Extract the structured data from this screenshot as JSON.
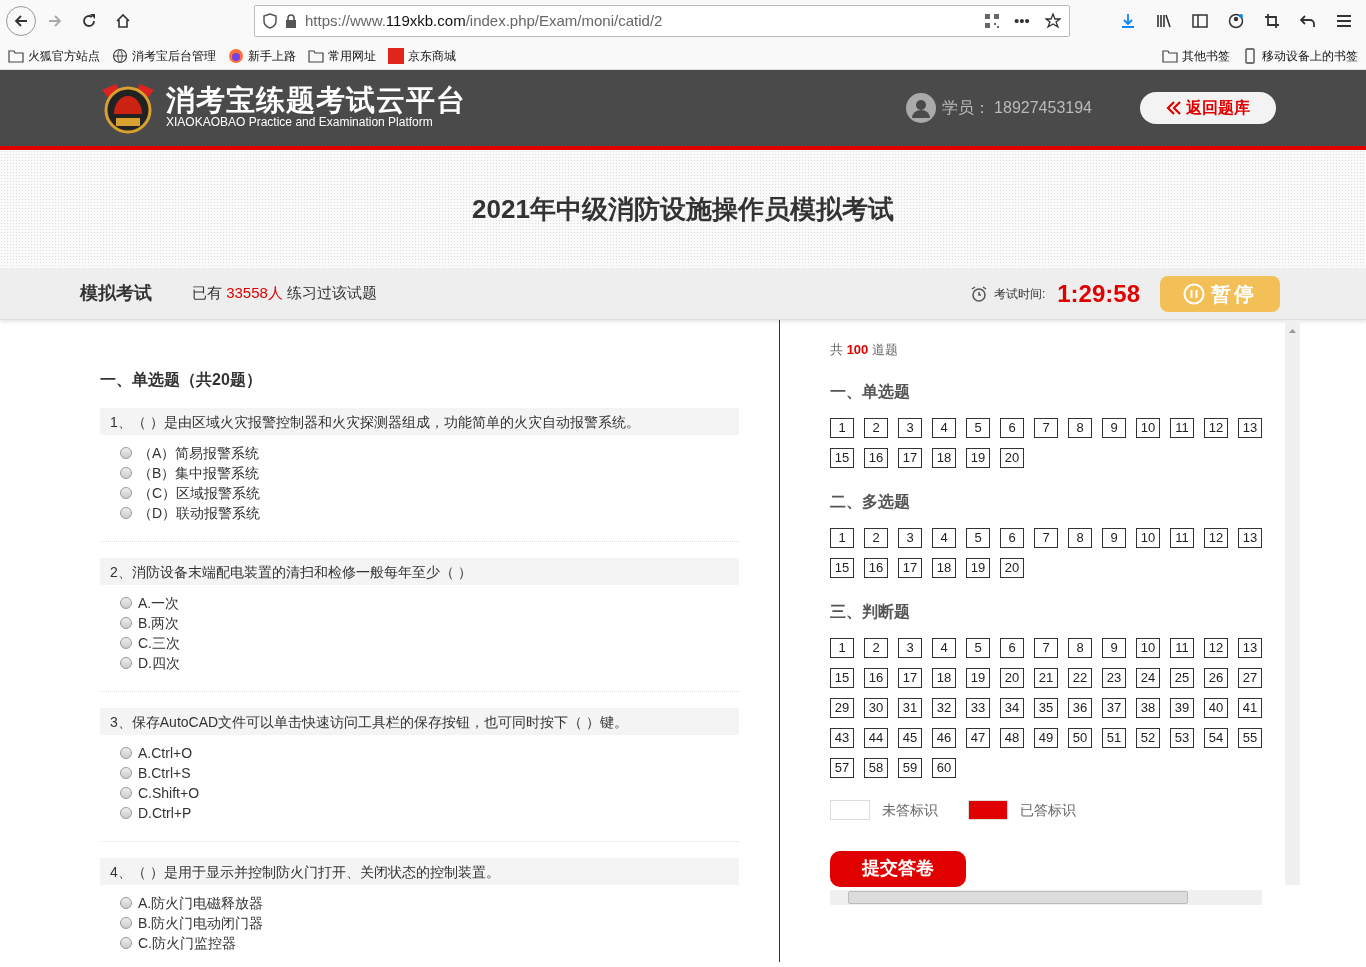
{
  "browser": {
    "url_prefix": "https://www.",
    "url_domain": "119xkb.com",
    "url_path": "/index.php/Exam/moni/catid/2",
    "menu_glyph": "•••",
    "bookmarks": [
      {
        "label": "火狐官方站点",
        "kind": "folder"
      },
      {
        "label": "消考宝后台管理",
        "kind": "globe"
      },
      {
        "label": "新手上路",
        "kind": "firefox"
      },
      {
        "label": "常用网址",
        "kind": "folder"
      },
      {
        "label": "京东商城",
        "kind": "jd"
      }
    ],
    "bookmarks_right": [
      {
        "label": "其他书签",
        "kind": "folder"
      },
      {
        "label": "移动设备上的书签",
        "kind": "mobile"
      }
    ]
  },
  "header": {
    "logo_title": "消考宝练题考试云平台",
    "logo_subtitle": "XIAOKAOBAO Practice and Examination Platform",
    "user_label": "学员：",
    "user_id": "18927453194",
    "back_button": "返回题库"
  },
  "exam_title": "2021年中级消防设施操作员模拟考试",
  "exam_bar": {
    "mode": "模拟考试",
    "count_prefix": "已有",
    "count": "33558人",
    "count_suffix": "练习过该试题",
    "timer_label": "考试时间:",
    "timer": "1:29:58",
    "pause_button": "暂停"
  },
  "section_title": "一、单选题（共20题）",
  "questions": [
    {
      "text": "1、（ ）是由区域火灾报警控制器和火灾探测器组成，功能简单的火灾自动报警系统。",
      "options": [
        {
          "label": "（A）简易报警系统",
          "selected": false
        },
        {
          "label": "（B）集中报警系统",
          "selected": false
        },
        {
          "label": "（C）区域报警系统",
          "selected": false
        },
        {
          "label": "（D）联动报警系统",
          "selected": false
        }
      ]
    },
    {
      "text": "2、消防设备末端配电装置的清扫和检修一般每年至少（ ）",
      "options": [
        {
          "label": "A.一次",
          "selected": false
        },
        {
          "label": "B.两次",
          "selected": false
        },
        {
          "label": "C.三次",
          "selected": false
        },
        {
          "label": "D.四次",
          "selected": false
        }
      ]
    },
    {
      "text": "3、保存AutoCAD文件可以单击快速访问工具栏的保存按钮，也可同时按下（ ）键。",
      "options": [
        {
          "label": "A.Ctrl+O",
          "selected": false
        },
        {
          "label": "B.Ctrl+S",
          "selected": false
        },
        {
          "label": "C.Shift+O",
          "selected": false
        },
        {
          "label": "D.Ctrl+P",
          "selected": false
        }
      ]
    },
    {
      "text": "4、（ ）是用于显示并控制防火门打开、关闭状态的控制装置。",
      "options": [
        {
          "label": "A.防火门电磁释放器",
          "selected": false
        },
        {
          "label": "B.防火门电动闭门器",
          "selected": false
        },
        {
          "label": "C.防火门监控器",
          "selected": false
        }
      ]
    }
  ],
  "navigator": {
    "total_prefix": "共",
    "total": "100",
    "total_suffix": "道题",
    "sections": [
      {
        "title": "一、单选题",
        "numbers": [
          "1",
          "2",
          "3",
          "4",
          "5",
          "6",
          "7",
          "8",
          "9",
          "10",
          "11",
          "12",
          "13",
          "15",
          "16",
          "17",
          "18",
          "19",
          "20"
        ]
      },
      {
        "title": "二、多选题",
        "numbers": [
          "1",
          "2",
          "3",
          "4",
          "5",
          "6",
          "7",
          "8",
          "9",
          "10",
          "11",
          "12",
          "13",
          "15",
          "16",
          "17",
          "18",
          "19",
          "20"
        ]
      },
      {
        "title": "三、判断题",
        "numbers": [
          "1",
          "2",
          "3",
          "4",
          "5",
          "6",
          "7",
          "8",
          "9",
          "10",
          "11",
          "12",
          "13",
          "15",
          "16",
          "17",
          "18",
          "19",
          "20",
          "21",
          "22",
          "23",
          "24",
          "25",
          "26",
          "27",
          "29",
          "30",
          "31",
          "32",
          "33",
          "34",
          "35",
          "36",
          "37",
          "38",
          "39",
          "40",
          "41",
          "43",
          "44",
          "45",
          "46",
          "47",
          "48",
          "49",
          "50",
          "51",
          "52",
          "53",
          "54",
          "55",
          "57",
          "58",
          "59",
          "60"
        ]
      }
    ],
    "legend": [
      {
        "label": "未答标识",
        "color": "#ffffff"
      },
      {
        "label": "已答标识",
        "color": "#e00000"
      }
    ],
    "submit_button": "提交答卷"
  }
}
